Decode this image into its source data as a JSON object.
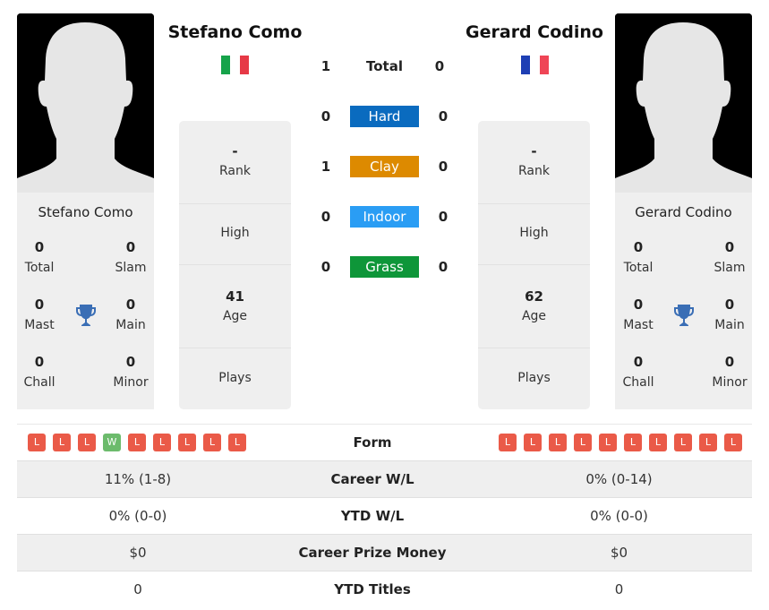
{
  "colors": {
    "hard": "#0a6bbf",
    "clay": "#dd8a00",
    "indoor": "#2a9df4",
    "grass": "#0e9639",
    "loss": "#ea5a48",
    "win": "#6cbb6c",
    "trophy": "#3a6eb5"
  },
  "player1": {
    "name": "Stefano Como",
    "flag": "italy-flag",
    "titles": {
      "total": {
        "value": "0",
        "label": "Total"
      },
      "slam": {
        "value": "0",
        "label": "Slam"
      },
      "mast": {
        "value": "0",
        "label": "Mast"
      },
      "main": {
        "value": "0",
        "label": "Main"
      },
      "chall": {
        "value": "0",
        "label": "Chall"
      },
      "minor": {
        "value": "0",
        "label": "Minor"
      }
    },
    "rank": {
      "value": "-",
      "label": "Rank"
    },
    "high": {
      "value": "",
      "label": "High"
    },
    "age": {
      "value": "41",
      "label": "Age"
    },
    "plays": {
      "value": "",
      "label": "Plays"
    },
    "form": [
      "L",
      "L",
      "L",
      "W",
      "L",
      "L",
      "L",
      "L",
      "L"
    ]
  },
  "player2": {
    "name": "Gerard Codino",
    "flag": "france-flag",
    "titles": {
      "total": {
        "value": "0",
        "label": "Total"
      },
      "slam": {
        "value": "0",
        "label": "Slam"
      },
      "mast": {
        "value": "0",
        "label": "Mast"
      },
      "main": {
        "value": "0",
        "label": "Main"
      },
      "chall": {
        "value": "0",
        "label": "Chall"
      },
      "minor": {
        "value": "0",
        "label": "Minor"
      }
    },
    "rank": {
      "value": "-",
      "label": "Rank"
    },
    "high": {
      "value": "",
      "label": "High"
    },
    "age": {
      "value": "62",
      "label": "Age"
    },
    "plays": {
      "value": "",
      "label": "Plays"
    },
    "form": [
      "L",
      "L",
      "L",
      "L",
      "L",
      "L",
      "L",
      "L",
      "L",
      "L"
    ]
  },
  "h2h": {
    "total": {
      "label": "Total",
      "p1": "1",
      "p2": "0"
    },
    "surfaces": [
      {
        "label": "Hard",
        "p1": "0",
        "p2": "0"
      },
      {
        "label": "Clay",
        "p1": "1",
        "p2": "0"
      },
      {
        "label": "Indoor",
        "p1": "0",
        "p2": "0"
      },
      {
        "label": "Grass",
        "p1": "0",
        "p2": "0"
      }
    ]
  },
  "comparison": {
    "form_label": "Form",
    "rows": [
      {
        "label": "Career W/L",
        "p1": "11% (1-8)",
        "p2": "0% (0-14)"
      },
      {
        "label": "YTD W/L",
        "p1": "0% (0-0)",
        "p2": "0% (0-0)"
      },
      {
        "label": "Career Prize Money",
        "p1": "$0",
        "p2": "$0"
      },
      {
        "label": "YTD Titles",
        "p1": "0",
        "p2": "0"
      }
    ]
  }
}
